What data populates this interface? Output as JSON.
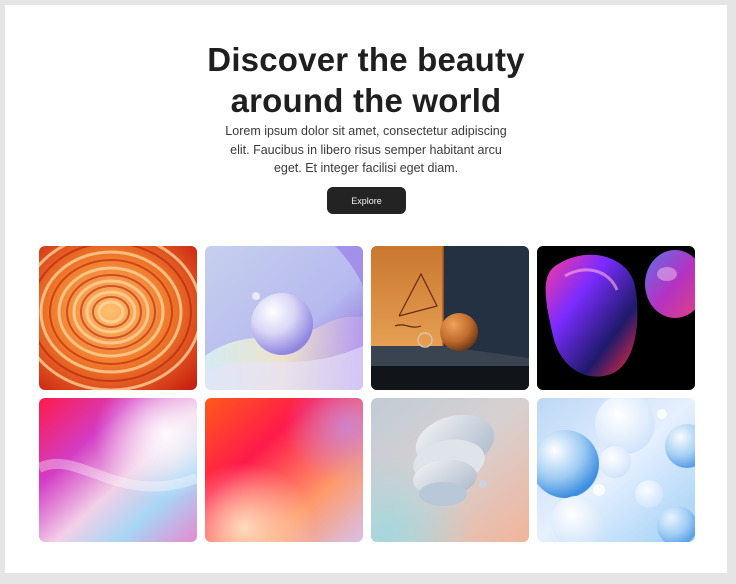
{
  "hero": {
    "title_lines": [
      "Discover the beauty",
      "around the world"
    ],
    "description_lines": [
      "Lorem ipsum dolor sit amet, consectetur adipiscing",
      "elit. Faucibus in libero risus semper habitant arcu",
      "eget. Et integer facilisi eget diam."
    ],
    "button_label": "Explore"
  },
  "gallery": {
    "images": [
      {
        "name": "orange-swirl-layers",
        "colors": [
          "#e8401a",
          "#ffb347"
        ]
      },
      {
        "name": "pastel-sphere-waves",
        "colors": [
          "#b8c6f0",
          "#8e6ef0"
        ]
      },
      {
        "name": "orange-ball-dark-room",
        "colors": [
          "#d98a3a",
          "#1f2a3a"
        ]
      },
      {
        "name": "iridescent-blob-black",
        "colors": [
          "#000000",
          "#e0208a"
        ]
      },
      {
        "name": "pink-violet-gradient",
        "colors": [
          "#ff2d6a",
          "#b6d8ff"
        ]
      },
      {
        "name": "red-orange-gradient",
        "colors": [
          "#ff3a3a",
          "#ffa04a"
        ]
      },
      {
        "name": "abstract-discs-sculpture",
        "colors": [
          "#c9d2dc",
          "#f0b8a0"
        ]
      },
      {
        "name": "blue-bubbles",
        "colors": [
          "#4fa3e8",
          "#e8f2ff"
        ]
      }
    ]
  }
}
